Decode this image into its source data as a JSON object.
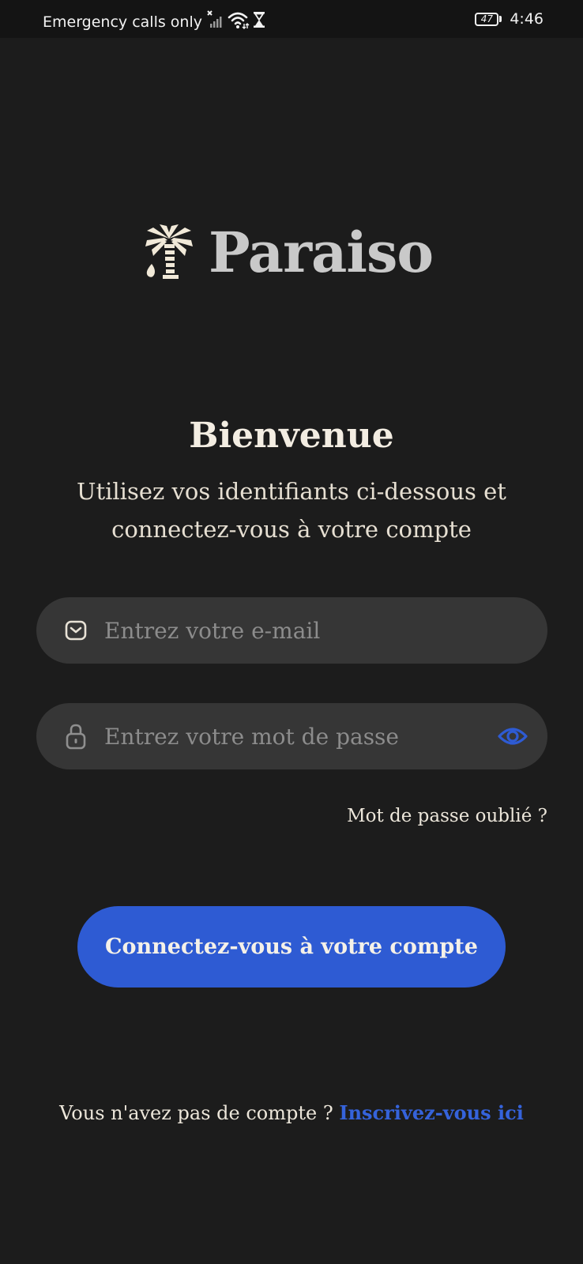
{
  "status_bar": {
    "carrier_text": "Emergency calls only",
    "time": "4:46",
    "battery_level": "47",
    "icons": [
      "no-signal-icon",
      "wifi-icon",
      "hourglass-icon",
      "battery-icon"
    ]
  },
  "brand": {
    "name": "Paraiso",
    "logo_icon": "palm-tree-icon"
  },
  "welcome": {
    "title": "Bienvenue",
    "subtitle": "Utilisez vos identifiants ci-dessous et connectez-vous à votre compte"
  },
  "form": {
    "email_placeholder": "Entrez votre e-mail",
    "email_icon": "mail-icon",
    "password_placeholder": "Entrez votre mot de passe",
    "password_icon": "lock-icon",
    "toggle_icon": "eye-icon",
    "forgot_label": "Mot de passe oublié ?",
    "submit_label": "Connectez-vous à votre compte"
  },
  "signup": {
    "prompt": "Vous n'avez pas de compte ?",
    "link_label": "Inscrivez-vous ici"
  },
  "colors": {
    "background": "#1c1c1c",
    "field": "#363636",
    "accent": "#2e5bd3",
    "text": "#ece6da"
  }
}
